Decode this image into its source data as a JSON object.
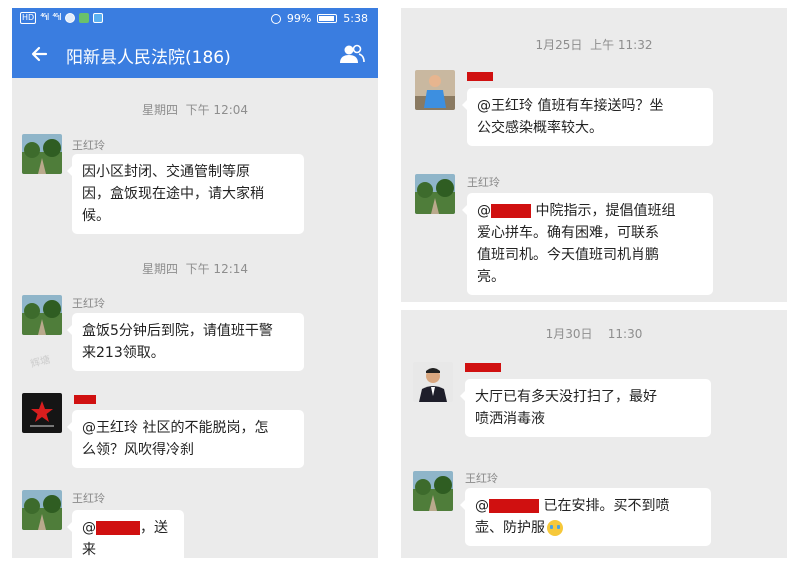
{
  "colors": {
    "header": "#3a7de0",
    "chat_bg": "#ebebeb",
    "bubble": "#ffffff",
    "redaction": "#d01010"
  },
  "status_bar": {
    "network": "HD",
    "signal_a": "⁴⁶ıl",
    "signal_b": "⁴⁶ıl",
    "battery": "99%",
    "time": "5:38"
  },
  "header": {
    "title": "阳新县人民法院(186)",
    "back_icon": "arrow-left-icon",
    "members_icon": "group-members-icon"
  },
  "left_chat": {
    "ts1": "星期四  下午 12:04",
    "ts2": "星期四  下午 12:14",
    "m1": {
      "sender": "王红玲",
      "line1": "因小区封闭、交通管制等原",
      "line2": "因，盒饭现在途中，请大家稍",
      "line3": "候。"
    },
    "m2": {
      "sender": "王红玲",
      "line1": "盒饭5分钟后到院，请值班干警",
      "line2": "来213领取。"
    },
    "m3": {
      "line1": "@王红玲 社区的不能脱岗，怎",
      "line2": "么领？风吹得冷刹"
    },
    "m4": {
      "sender": "王红玲",
      "prefix": "@",
      "suffix": "，送来"
    }
  },
  "right_top_chat": {
    "ts": "1月25日  上午 11:32",
    "m1": {
      "line1": "@王红玲  值班有车接送吗？坐",
      "line2": "公交感染概率较大。"
    },
    "m2": {
      "sender": "王红玲",
      "prefix": "@",
      "line1_rest": " 中院指示，提倡值班组",
      "line2": "爱心拼车。确有困难，可联系",
      "line3": "值班司机。今天值班司机肖鹏",
      "line4": "亮。"
    }
  },
  "right_bottom_chat": {
    "ts": "1月30日    11:30",
    "m1": {
      "line1": "大厅已有多天没打扫了，最好",
      "line2": "喷洒消毒液"
    },
    "m2": {
      "sender": "王红玲",
      "prefix": "@",
      "line1_rest": " 已在安排。买不到喷",
      "line2": "壶、防护服"
    }
  },
  "watermark": "辉塘"
}
